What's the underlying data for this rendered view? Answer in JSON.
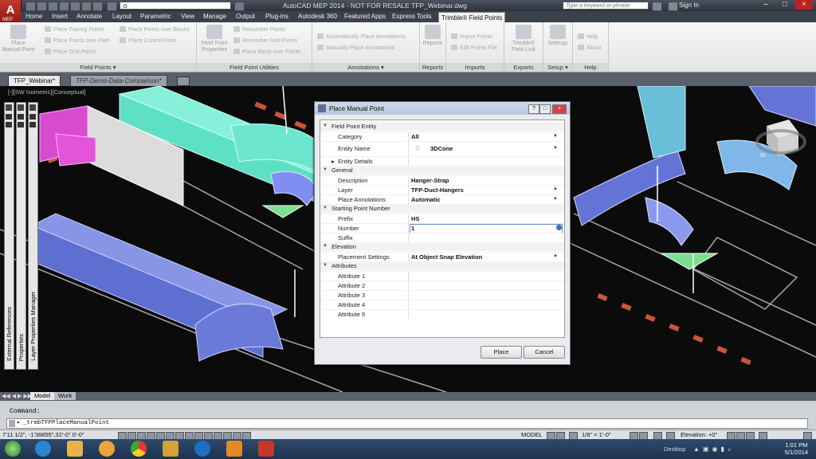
{
  "title_bar": {
    "title": "AutoCAD MEP 2014 - NOT FOR RESALE    TFP_Webinar.dwg",
    "layer_value": "0",
    "search_placeholder": "Type a keyword or phrase",
    "sign_in": "Sign In",
    "app_label": "MEP"
  },
  "ribbon_tabs": [
    "Home",
    "Insert",
    "Annotate",
    "Layout",
    "Parametric",
    "View",
    "Manage",
    "Output",
    "Plug-ins",
    "Autodesk 360",
    "Featured Apps",
    "Express Tools",
    "Trimble® Field Points"
  ],
  "ribbon": {
    "panels": [
      {
        "title": "Field Points ▾",
        "big": [
          "Place Manual Point"
        ],
        "small": [
          "Place Tracing Points",
          "Place Points over Path",
          "Place Grid Points",
          "Place Points over Blocks",
          "Place Control Point"
        ]
      },
      {
        "title": "Field Point Utilities",
        "big": [
          "Field Point Properties"
        ],
        "small": [
          "Renumber Points",
          "Renumber Grid Points",
          "Place Block over Points"
        ]
      },
      {
        "title": "Annotations ▾",
        "small": [
          "Automatically Place Annotations",
          "Manually Place Annotations"
        ]
      },
      {
        "title": "Reports",
        "big": [
          "Reports"
        ]
      },
      {
        "title": "Imports",
        "small": [
          "Import Points",
          "Edit Points File"
        ]
      },
      {
        "title": "Exports",
        "big": [
          "Trimble® Field Link"
        ]
      },
      {
        "title": "Setup ▾",
        "big": [
          "Settings"
        ]
      },
      {
        "title": "Help",
        "small": [
          "Help",
          "About"
        ]
      }
    ]
  },
  "doc_tabs": [
    "TFP_Webinar*",
    "TFP-Demo-Data-Comparison*"
  ],
  "viewport_label": "[-][SW Isometric][Conceptual]",
  "compass_label": "W",
  "palettes": [
    "External References",
    "Properties",
    "Layer Properties Manager"
  ],
  "model_tabs": [
    "Model",
    "Work"
  ],
  "command": {
    "label": "Command:",
    "line": "_trmbTFPPlaceManualPoint"
  },
  "status_bar": {
    "coords": "7'11 1/2\", -1'36855\",32'-0\" 0'-0\"",
    "model": "MODEL",
    "scale": "1/8\" = 1'-0\"",
    "elevation": "Elevation: +0\""
  },
  "taskbar": {
    "desktop": "Desktop",
    "time": "1:01 PM",
    "date": "5/1/2014"
  },
  "dialog": {
    "title": "Place Manual Point",
    "sections": [
      {
        "name": "Field Point Entity",
        "rows": [
          {
            "key": "Category",
            "value": "All",
            "dropdown": true
          },
          {
            "key": "Entity Name",
            "value": "3DCone",
            "dropdown": true
          },
          {
            "key": "Entity Details",
            "value": "",
            "collapsed": true
          }
        ]
      },
      {
        "name": "General",
        "rows": [
          {
            "key": "Description",
            "value": "Hanger-Strap"
          },
          {
            "key": "Layer",
            "value": "TFP-Duct-Hangers",
            "dropdown": true
          },
          {
            "key": "Place Annotations",
            "value": "Automatic",
            "dropdown": true
          }
        ]
      },
      {
        "name": "Starting Point Number",
        "rows": [
          {
            "key": "Prefix",
            "value": "HS"
          },
          {
            "key": "Number",
            "value": "1"
          },
          {
            "key": "Suffix",
            "value": ""
          }
        ]
      },
      {
        "name": "Elevation",
        "rows": [
          {
            "key": "Placement Settings",
            "value": "At Object Snap Elevation",
            "dropdown": true
          }
        ]
      },
      {
        "name": "Attributes",
        "rows": [
          {
            "key": "Attribute 1",
            "value": ""
          },
          {
            "key": "Attribute 2",
            "value": ""
          },
          {
            "key": "Attribute 3",
            "value": ""
          },
          {
            "key": "Attribute 4",
            "value": ""
          },
          {
            "key": "Attribute 5",
            "value": ""
          }
        ]
      }
    ],
    "place_label": "Place",
    "cancel_label": "Cancel"
  }
}
